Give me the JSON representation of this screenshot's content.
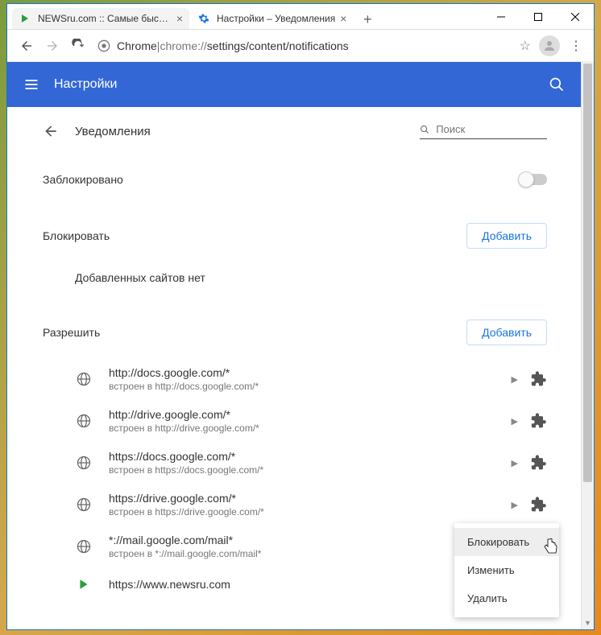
{
  "window": {
    "tabs": [
      {
        "title": "NEWSru.com :: Самые быстрые"
      },
      {
        "title": "Настройки – Уведомления"
      }
    ]
  },
  "address": {
    "prefix": "Chrome",
    "sep": " | ",
    "proto": "chrome://",
    "path": "settings/content/notifications"
  },
  "header": {
    "title": "Настройки"
  },
  "page": {
    "title": "Уведомления",
    "search_placeholder": "Поиск",
    "blocked_label": "Заблокировано",
    "block_section": "Блокировать",
    "allow_section": "Разрешить",
    "add_btn": "Добавить",
    "empty_block": "Добавленных сайтов нет",
    "embed_prefix": "встроен в "
  },
  "allow_sites": [
    {
      "url": "http://docs.google.com/*",
      "embed": "http://docs.google.com/*",
      "icon": "globe"
    },
    {
      "url": "http://drive.google.com/*",
      "embed": "http://drive.google.com/*",
      "icon": "globe"
    },
    {
      "url": "https://docs.google.com/*",
      "embed": "https://docs.google.com/*",
      "icon": "globe"
    },
    {
      "url": "https://drive.google.com/*",
      "embed": "https://drive.google.com/*",
      "icon": "globe"
    },
    {
      "url": "*://mail.google.com/mail*",
      "embed": "*://mail.google.com/mail*",
      "icon": "globe"
    },
    {
      "url": "https://www.newsru.com",
      "embed": "",
      "icon": "newsru"
    }
  ],
  "context_menu": {
    "items": [
      "Блокировать",
      "Изменить",
      "Удалить"
    ]
  }
}
